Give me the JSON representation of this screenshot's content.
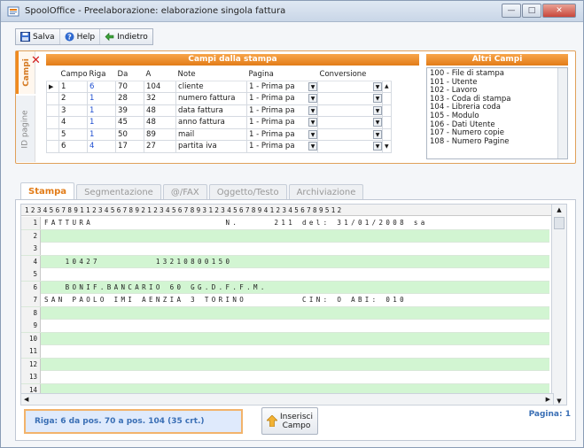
{
  "window": {
    "title": "SpoolOffice - Preelaborazione: elaborazione singola fattura",
    "controls": [
      "minimize",
      "maximize",
      "close"
    ]
  },
  "toolbar": {
    "save_label": "Salva",
    "help_label": "Help",
    "back_label": "Indietro"
  },
  "side_tabs": {
    "campi": "Campi",
    "id_pagine": "ID pagine"
  },
  "campi": {
    "header": "Campi dalla stampa",
    "columns": [
      "Campo",
      "Riga",
      "Da",
      "A",
      "Note",
      "Pagina",
      "Conversione"
    ],
    "rows": [
      {
        "campo": "1",
        "riga": "6",
        "da": "70",
        "a": "104",
        "note": "cliente",
        "pagina": "1 - Prima pa",
        "conv": ""
      },
      {
        "campo": "2",
        "riga": "1",
        "da": "28",
        "a": "32",
        "note": "numero fattura",
        "pagina": "1 - Prima pa",
        "conv": ""
      },
      {
        "campo": "3",
        "riga": "1",
        "da": "39",
        "a": "48",
        "note": "data fattura",
        "pagina": "1 - Prima pa",
        "conv": ""
      },
      {
        "campo": "4",
        "riga": "1",
        "da": "45",
        "a": "48",
        "note": "anno fattura",
        "pagina": "1 - Prima pa",
        "conv": ""
      },
      {
        "campo": "5",
        "riga": "1",
        "da": "50",
        "a": "89",
        "note": "mail",
        "pagina": "1 - Prima pa",
        "conv": ""
      },
      {
        "campo": "6",
        "riga": "4",
        "da": "17",
        "a": "27",
        "note": "partita iva",
        "pagina": "1 - Prima pa",
        "conv": ""
      }
    ]
  },
  "altri_campi": {
    "header": "Altri Campi",
    "items": [
      "100 - File di stampa",
      "101 - Utente",
      "102 - Lavoro",
      "103 - Coda di stampa",
      "104 - Libreria coda",
      "105 - Modulo",
      "106 - Dati Utente",
      "107 - Numero copie",
      "108 - Numero Pagine"
    ]
  },
  "tabs": [
    "Stampa",
    "Segmentazione",
    "@/FAX",
    "Oggetto/Testo",
    "Archiviazione"
  ],
  "ruler": "1234567891123456789212345678931234567894123456789512",
  "print_rows": [
    {
      "n": "1",
      "text": "FATTURA                   N.     211 del: 31/01/2008 sa"
    },
    {
      "n": "2",
      "text": ""
    },
    {
      "n": "3",
      "text": ""
    },
    {
      "n": "4",
      "text": "   10427        13210800150"
    },
    {
      "n": "5",
      "text": ""
    },
    {
      "n": "6",
      "text": "   BONIF.BANCARIO 60 GG.D.F.F.M."
    },
    {
      "n": "7",
      "text": "SAN PAOLO IMI AENZIA 3 TORINO        CIN: O ABI: 010"
    },
    {
      "n": "8",
      "text": ""
    },
    {
      "n": "9",
      "text": ""
    },
    {
      "n": "10",
      "text": ""
    },
    {
      "n": "11",
      "text": ""
    },
    {
      "n": "12",
      "text": ""
    },
    {
      "n": "13",
      "text": ""
    },
    {
      "n": "14",
      "text": ""
    }
  ],
  "status": {
    "selection": "Riga: 6 da pos. 70 a pos. 104 (35 crt.)",
    "insert_label_1": "Inserisci",
    "insert_label_2": "Campo",
    "page": "Pagina: 1"
  }
}
